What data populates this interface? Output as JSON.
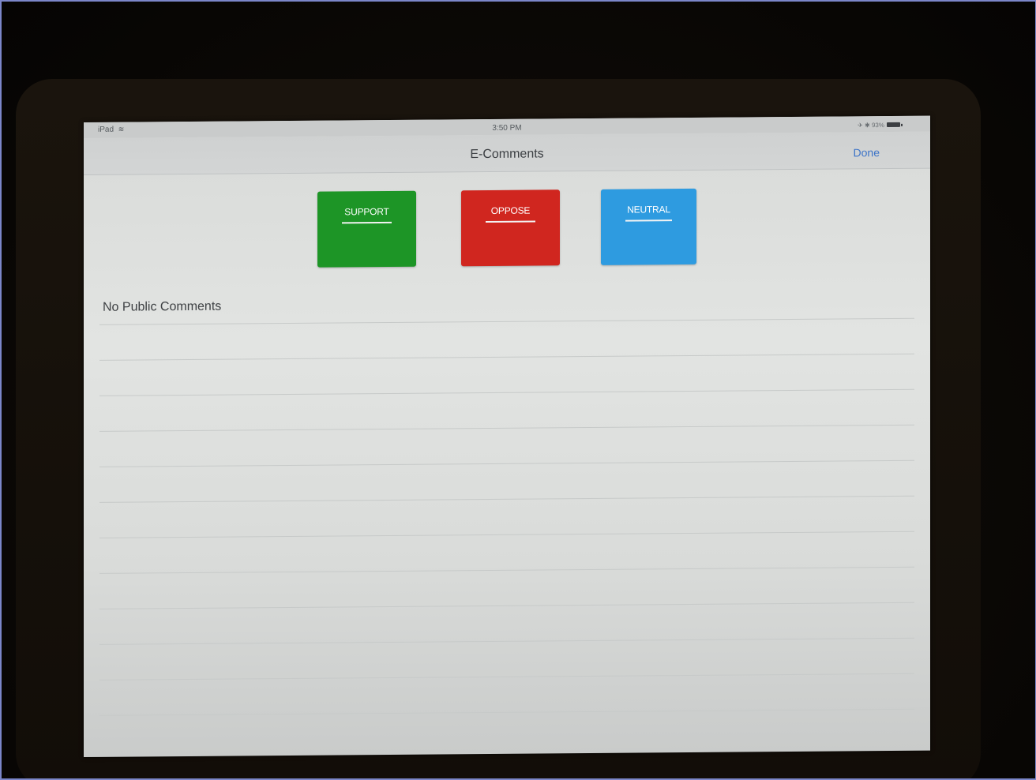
{
  "status_bar": {
    "carrier": "iPad",
    "wifi_icon": "wifi-icon",
    "time": "3:50 PM",
    "right_status": "✈ ✱ 93%",
    "battery_icon": "battery-icon"
  },
  "nav": {
    "title": "E-Comments",
    "done_label": "Done"
  },
  "vote_buttons": [
    {
      "label": "SUPPORT",
      "color": "#1d9526"
    },
    {
      "label": "OPPOSE",
      "color": "#d0261f"
    },
    {
      "label": "NEUTRAL",
      "color": "#2e9be0"
    }
  ],
  "comments": {
    "empty_message": "No Public Comments"
  },
  "colors": {
    "accent": "#3d74c8",
    "screen_background": "#dfe1df"
  }
}
